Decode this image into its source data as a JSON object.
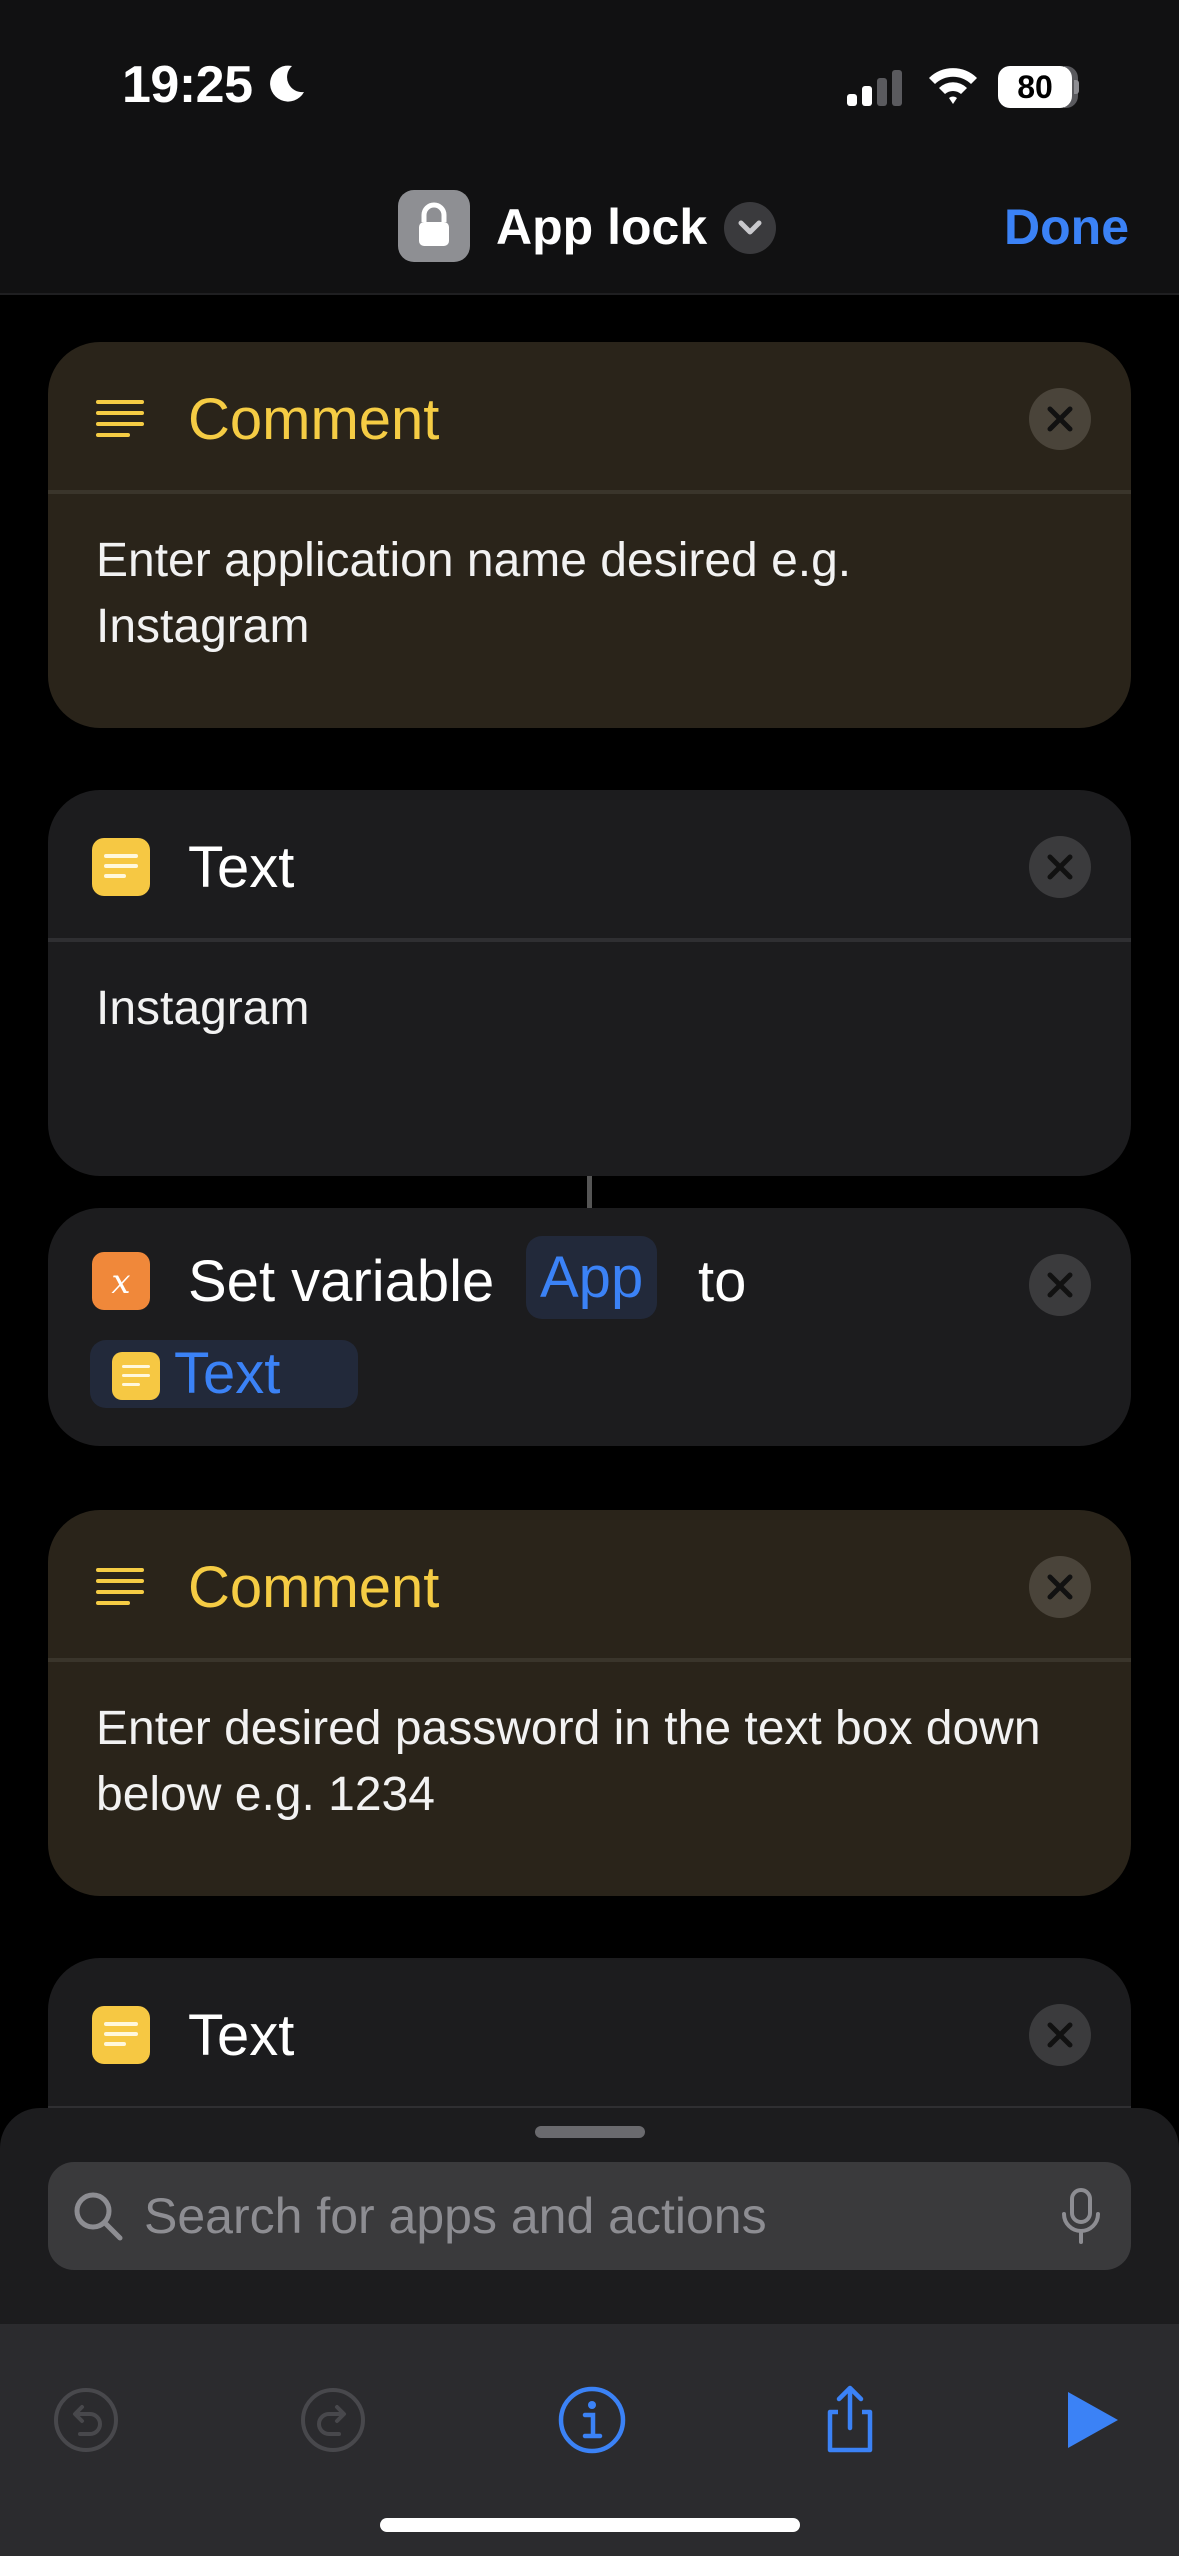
{
  "status": {
    "time": "19:25",
    "battery": "80"
  },
  "nav": {
    "title": "App lock",
    "done_label": "Done"
  },
  "actions": [
    {
      "type": "comment",
      "title": "Comment",
      "body": "Enter application name desired e.g. Instagram",
      "icon": "lines-icon"
    },
    {
      "type": "text",
      "title": "Text",
      "body": "Instagram",
      "icon": "text-doc-icon"
    },
    {
      "type": "set-variable",
      "prefix": "Set variable",
      "variable": "App",
      "connector": "to",
      "value": "Text",
      "icon": "variable-x-icon"
    },
    {
      "type": "comment",
      "title": "Comment",
      "body": "Enter desired password in the text box down below e.g. 1234",
      "icon": "lines-icon"
    },
    {
      "type": "text",
      "title": "Text",
      "body": "",
      "icon": "text-doc-icon"
    }
  ],
  "search": {
    "placeholder": "Search for apps and actions"
  },
  "toolbar": {
    "icons": [
      "undo-icon",
      "redo-icon",
      "info-icon",
      "share-icon",
      "play-icon"
    ]
  },
  "colors": {
    "accent": "#3b82f6",
    "comment_yellow": "#f5cc44",
    "variable_orange": "#f0883a"
  }
}
